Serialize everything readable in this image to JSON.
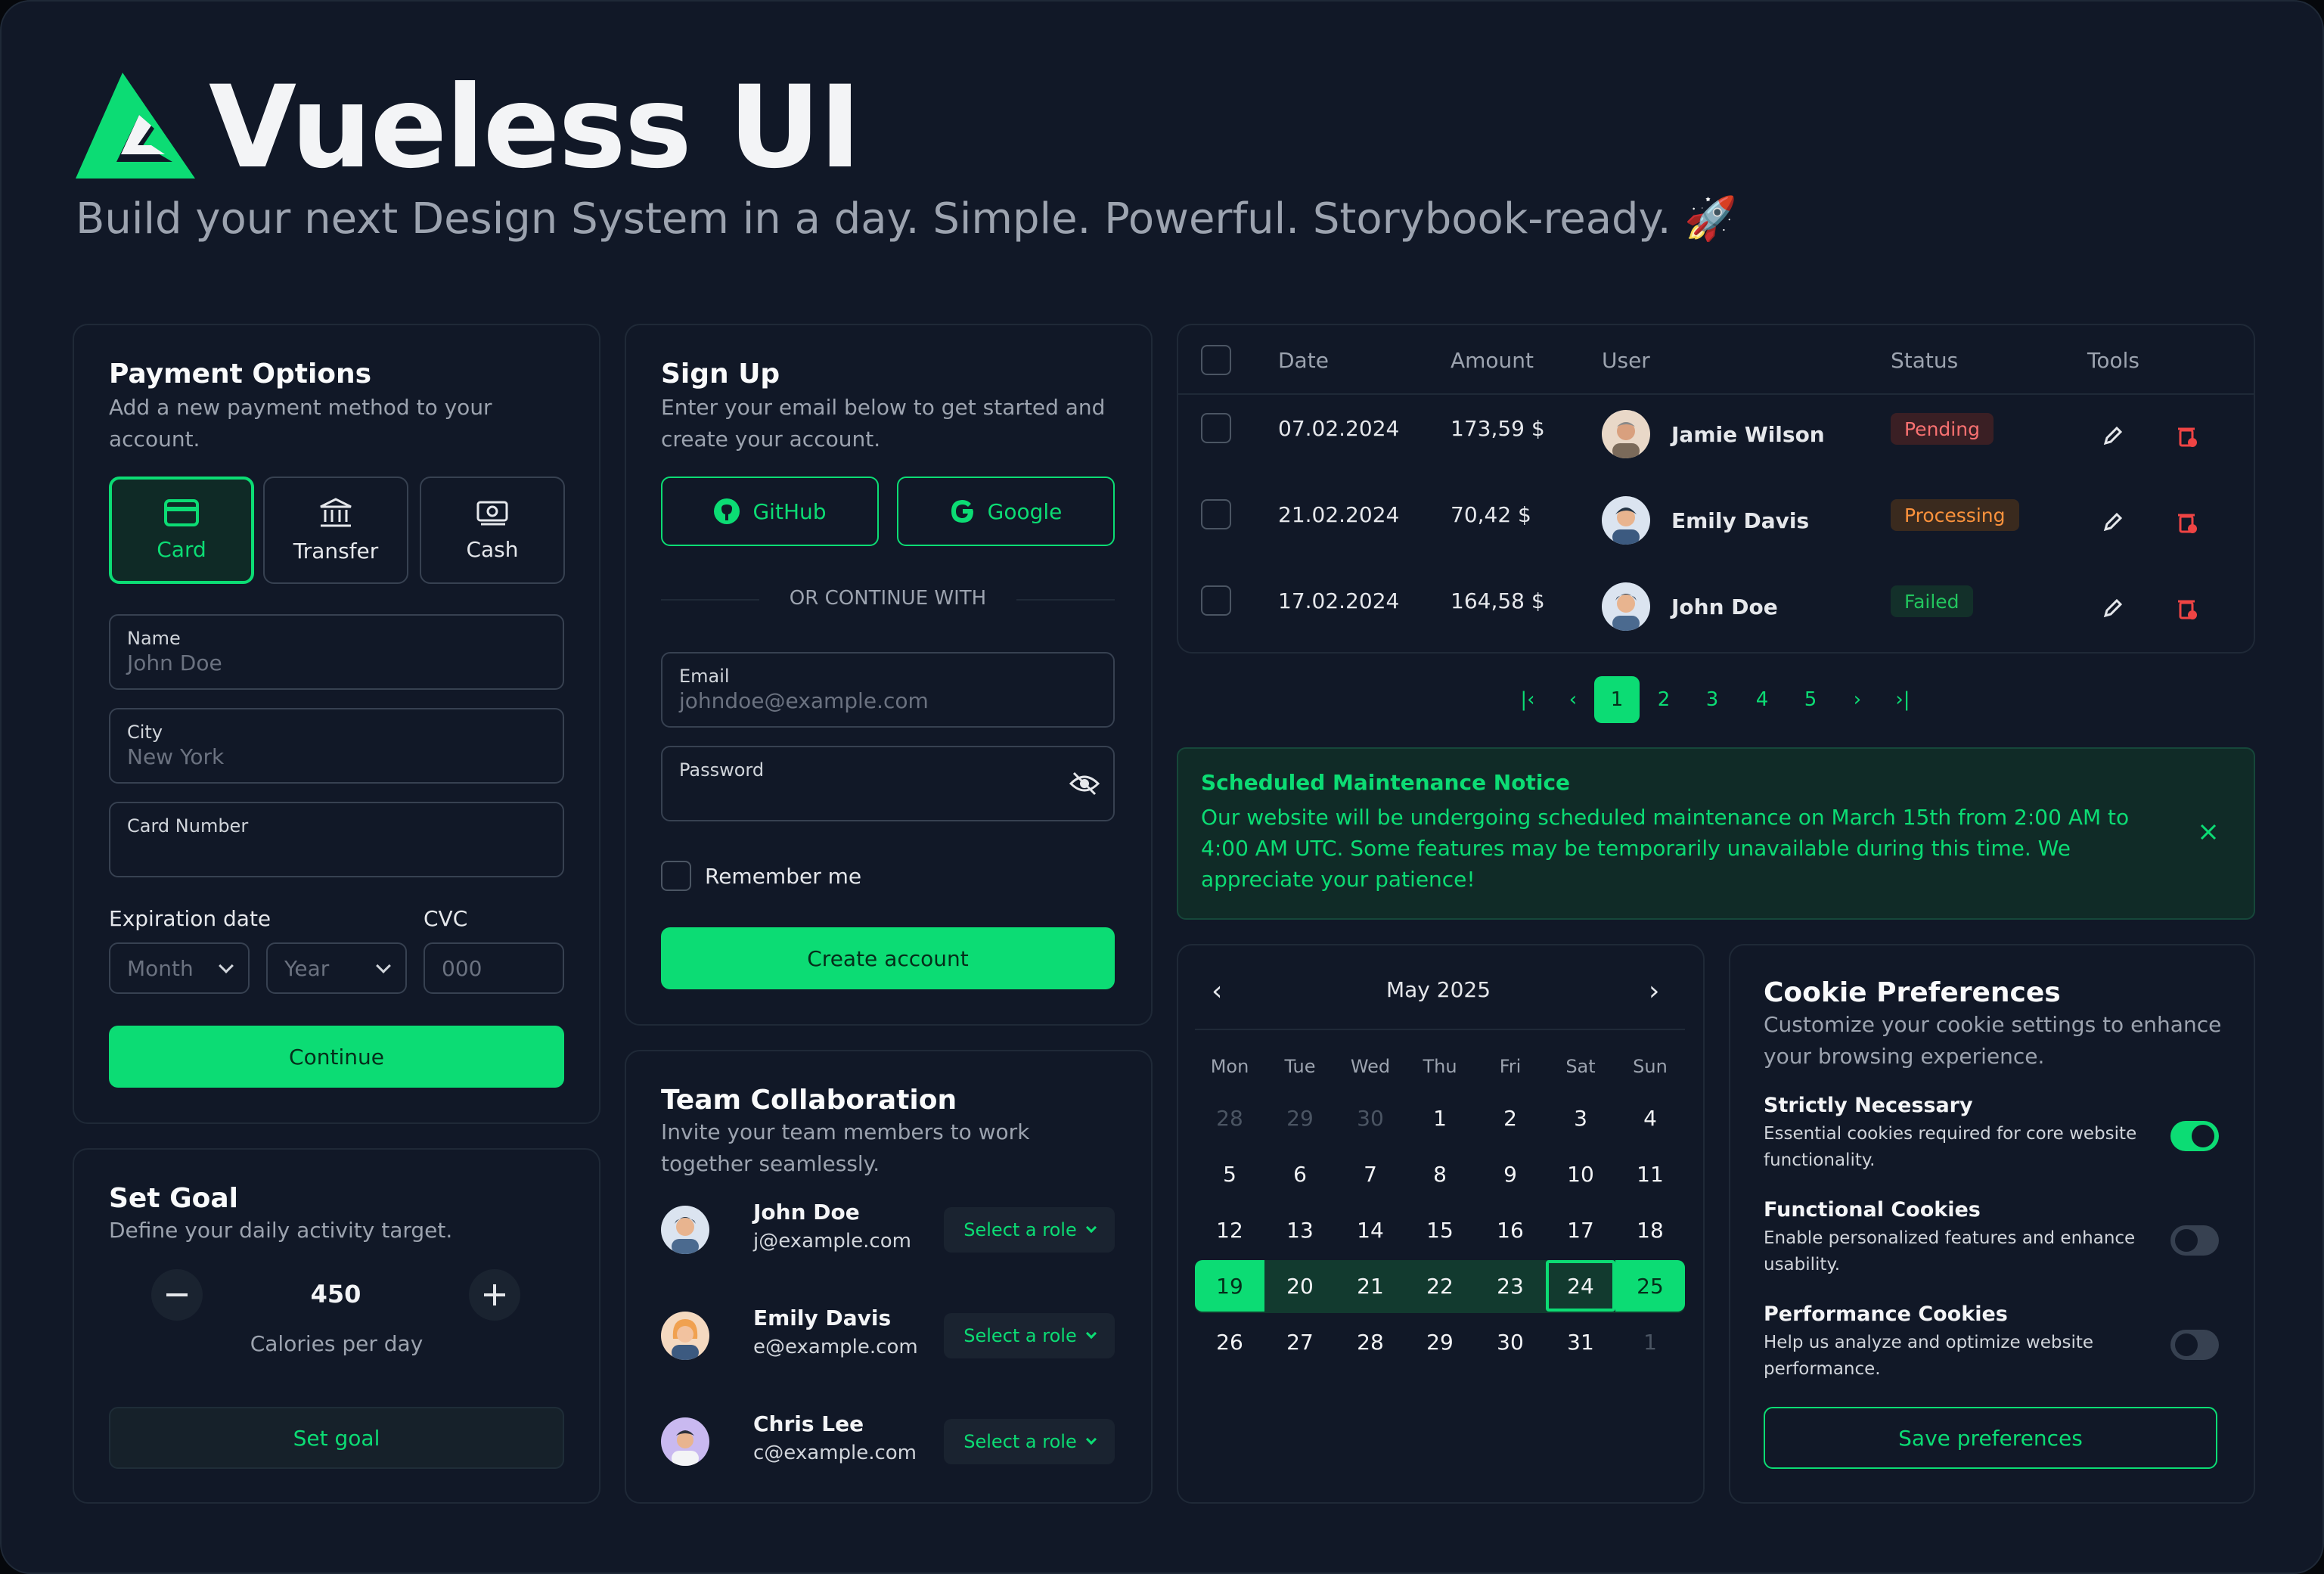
{
  "brand": {
    "name": "Vueless UI",
    "tagline": "Build your next Design System in a day. Simple. Powerful. Storybook-ready. 🚀",
    "accent": "#0cdc74"
  },
  "payment": {
    "title": "Payment Options",
    "desc": "Add a new payment method to your account.",
    "options": [
      {
        "label": "Card",
        "icon": "card-icon",
        "selected": true
      },
      {
        "label": "Transfer",
        "icon": "bank-icon",
        "selected": false
      },
      {
        "label": "Cash",
        "icon": "cash-icon",
        "selected": false
      }
    ],
    "name_label": "Name",
    "name_placeholder": "John Doe",
    "city_label": "City",
    "city_placeholder": "New York",
    "card_label": "Card Number",
    "exp_label": "Expiration date",
    "month": "Month",
    "year": "Year",
    "cvc_label": "CVC",
    "cvc_placeholder": "000",
    "continue": "Continue"
  },
  "goal": {
    "title": "Set Goal",
    "desc": "Define your daily activity target.",
    "value": "450",
    "unit": "Calories per day",
    "button": "Set goal"
  },
  "signup": {
    "title": "Sign Up",
    "desc": "Enter your email below to get started and create your account.",
    "github": "GitHub",
    "google": "Google",
    "divider": "OR CONTINUE WITH",
    "email_label": "Email",
    "email_placeholder": "johndoe@example.com",
    "password_label": "Password",
    "remember": "Remember me",
    "create": "Create account"
  },
  "team": {
    "title": "Team Collaboration",
    "desc": "Invite your team members to work together seamlessly.",
    "members": [
      {
        "name": "John Doe",
        "email": "j@example.com",
        "role": "Select a role"
      },
      {
        "name": "Emily Davis",
        "email": "e@example.com",
        "role": "Select a role"
      },
      {
        "name": "Chris Lee",
        "email": "c@example.com",
        "role": "Select a role"
      }
    ]
  },
  "table": {
    "headers": [
      "Date",
      "Amount",
      "User",
      "Status",
      "Tools"
    ],
    "rows": [
      {
        "date": "07.02.2024",
        "amount": "173,59 $",
        "user": "Jamie Wilson",
        "status": "Pending"
      },
      {
        "date": "21.02.2024",
        "amount": "70,42 $",
        "user": "Emily Davis",
        "status": "Processing"
      },
      {
        "date": "17.02.2024",
        "amount": "164,58 $",
        "user": "John Doe",
        "status": "Failed"
      }
    ],
    "status_colors": {
      "Pending": "#f87171",
      "Processing": "#fb923c",
      "Failed": "#22c55e"
    }
  },
  "pagination": {
    "pages": [
      "1",
      "2",
      "3",
      "4",
      "5"
    ],
    "current": "1"
  },
  "notice": {
    "title": "Scheduled Maintenance Notice",
    "body": "Our website will be undergoing scheduled maintenance on March 15th from 2:00 AM to 4:00 AM UTC. Some features may be temporarily unavailable during this time. We appreciate your patience!"
  },
  "calendar": {
    "month": "May 2025",
    "weekdays": [
      "Mon",
      "Tue",
      "Wed",
      "Thu",
      "Fri",
      "Sat",
      "Sun"
    ],
    "weeks": [
      [
        "28",
        "29",
        "30",
        "1",
        "2",
        "3",
        "4"
      ],
      [
        "5",
        "6",
        "7",
        "8",
        "9",
        "10",
        "11"
      ],
      [
        "12",
        "13",
        "14",
        "15",
        "16",
        "17",
        "18"
      ],
      [
        "19",
        "20",
        "21",
        "22",
        "23",
        "24",
        "25"
      ],
      [
        "26",
        "27",
        "28",
        "29",
        "30",
        "31",
        "1"
      ]
    ],
    "range_start": "19",
    "range_end": "25",
    "today": "24"
  },
  "cookies": {
    "title": "Cookie Preferences",
    "desc": "Customize your cookie settings to enhance your browsing experience.",
    "items": [
      {
        "title": "Strictly Necessary",
        "desc": "Essential cookies required for core website functionality.",
        "enabled": true
      },
      {
        "title": "Functional Cookies",
        "desc": "Enable personalized features and enhance usability.",
        "enabled": false
      },
      {
        "title": "Performance Cookies",
        "desc": "Help us analyze and optimize website performance.",
        "enabled": false
      }
    ],
    "save": "Save preferences"
  }
}
